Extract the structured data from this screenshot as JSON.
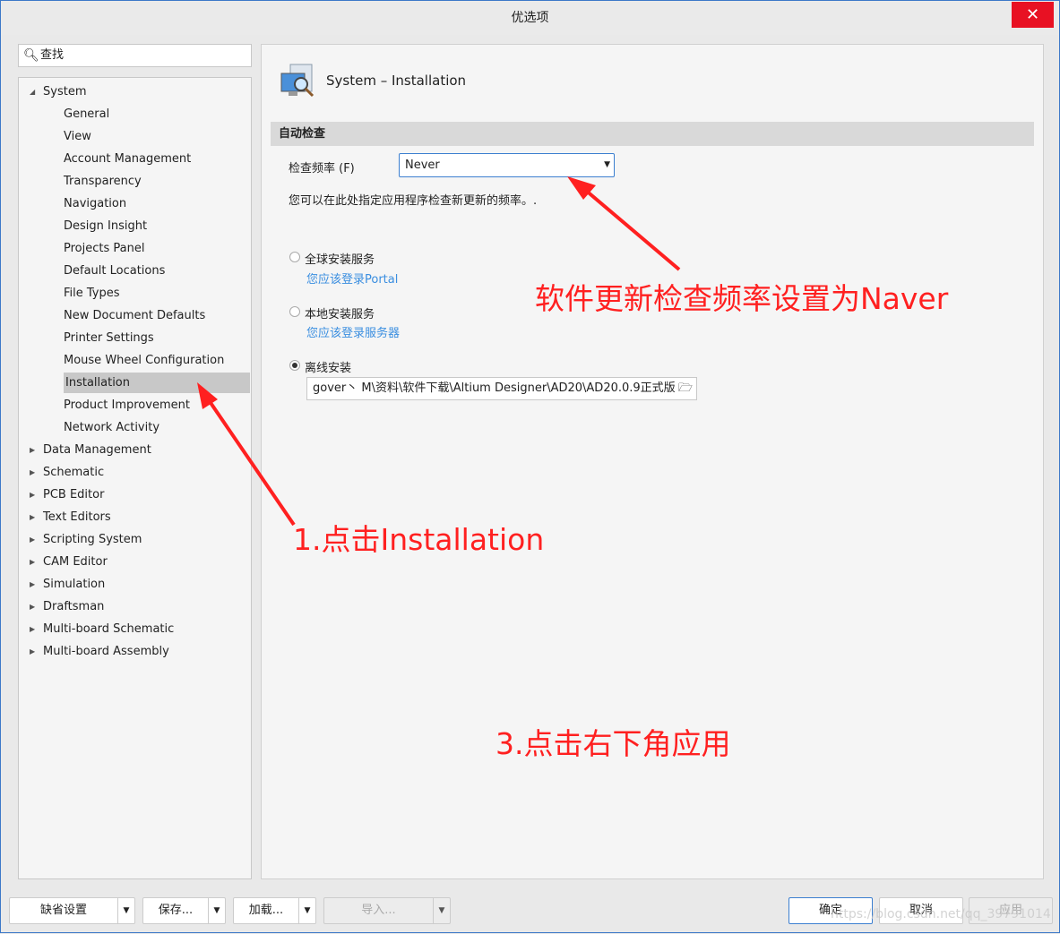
{
  "window": {
    "title": "优选项",
    "close_icon": "close-icon"
  },
  "search": {
    "placeholder": "查找"
  },
  "tree": [
    {
      "label": "System",
      "level": 0,
      "expanded": true
    },
    {
      "label": "General",
      "level": 1
    },
    {
      "label": "View",
      "level": 1
    },
    {
      "label": "Account Management",
      "level": 1
    },
    {
      "label": "Transparency",
      "level": 1
    },
    {
      "label": "Navigation",
      "level": 1
    },
    {
      "label": "Design Insight",
      "level": 1
    },
    {
      "label": "Projects Panel",
      "level": 1
    },
    {
      "label": "Default Locations",
      "level": 1
    },
    {
      "label": "File Types",
      "level": 1
    },
    {
      "label": "New Document Defaults",
      "level": 1
    },
    {
      "label": "Printer Settings",
      "level": 1
    },
    {
      "label": "Mouse Wheel Configuration",
      "level": 1
    },
    {
      "label": "Installation",
      "level": 1,
      "selected": true
    },
    {
      "label": "Product Improvement",
      "level": 1
    },
    {
      "label": "Network Activity",
      "level": 1
    },
    {
      "label": "Data Management",
      "level": 0
    },
    {
      "label": "Schematic",
      "level": 0
    },
    {
      "label": "PCB Editor",
      "level": 0
    },
    {
      "label": "Text Editors",
      "level": 0
    },
    {
      "label": "Scripting System",
      "level": 0
    },
    {
      "label": "CAM Editor",
      "level": 0
    },
    {
      "label": "Simulation",
      "level": 0
    },
    {
      "label": "Draftsman",
      "level": 0
    },
    {
      "label": "Multi-board Schematic",
      "level": 0
    },
    {
      "label": "Multi-board Assembly",
      "level": 0
    }
  ],
  "main": {
    "title": "System – Installation",
    "section": "自动检查",
    "freq_label": "检查频率 (F)",
    "freq_value": "Never",
    "freq_desc": "您可以在此处指定应用程序检查新更新的频率。.",
    "options": [
      {
        "label": "全球安装服务",
        "link": "您应该登录Portal",
        "checked": false
      },
      {
        "label": "本地安装服务",
        "link": "您应该登录服务器",
        "checked": false
      },
      {
        "label": "离线安装",
        "checked": true
      }
    ],
    "path_value": "gover丶 M\\资料\\软件下载\\Altium Designer\\AD20\\AD20.0.9正式版"
  },
  "buttons": {
    "defaults": "缺省设置",
    "save": "保存...",
    "load": "加载...",
    "import": "导入...",
    "ok": "确定",
    "cancel": "取消",
    "apply": "应用"
  },
  "annotations": {
    "a1": "软件更新检查频率设置为Naver",
    "a2": "1.点击Installation",
    "a3": "3.点击右下角应用",
    "color": "#ff2020"
  },
  "watermark": "https://blog.csdn.net/qq_39791014"
}
